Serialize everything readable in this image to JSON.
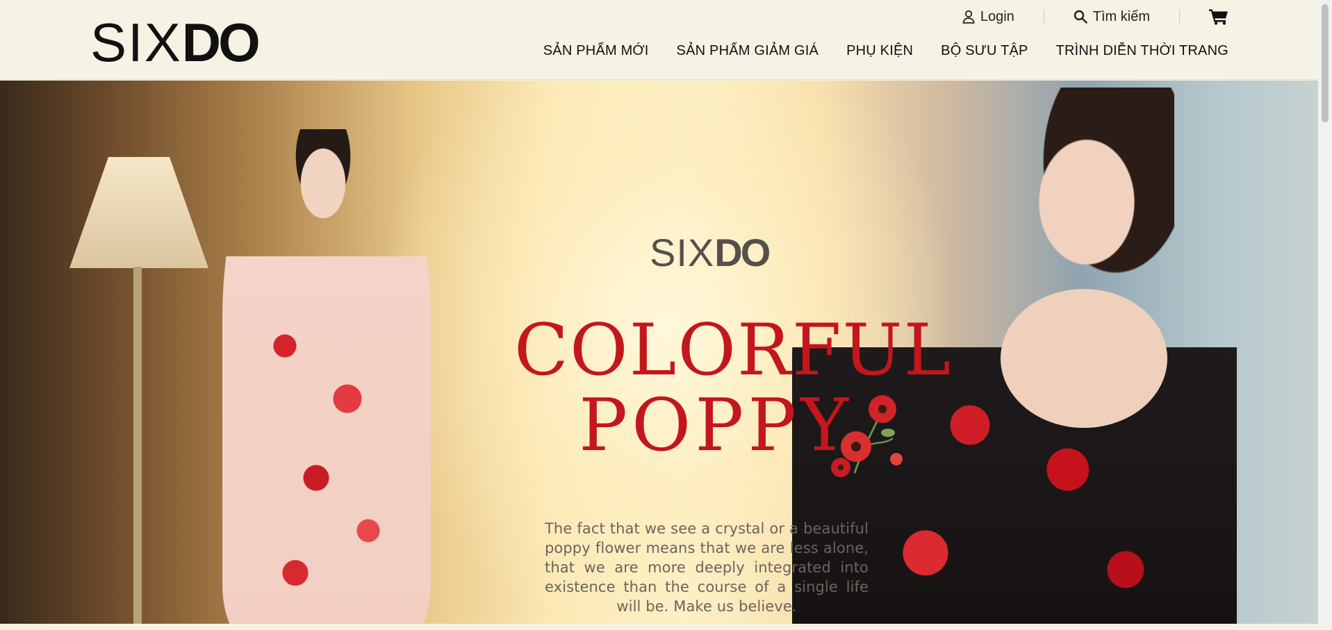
{
  "header": {
    "logo": {
      "thin": "SIX",
      "bold": "DO"
    },
    "topbar": {
      "login_label": "Login",
      "search_label": "Tìm kiếm"
    },
    "nav": [
      {
        "label": "SẢN PHẨM MỚI"
      },
      {
        "label": "SẢN PHẨM GIẢM GIÁ"
      },
      {
        "label": "PHỤ KIỆN"
      },
      {
        "label": "BỘ SƯU TẬP"
      },
      {
        "label": "TRÌNH DIỄN THỜI TRANG"
      }
    ]
  },
  "hero": {
    "brand": {
      "thin": "SIX",
      "bold": "DO"
    },
    "title_line1": "COLORFUL",
    "title_line2": "POPPY",
    "text": "The fact that we see a crystal or a beautiful poppy flower means that we are less alone, that we are more deeply integrated into existence than the course of a single life will be. Make us believe."
  },
  "icons": {
    "user": "user-icon",
    "search": "search-icon",
    "cart": "cart-icon",
    "poppy": "poppy-flower-icon"
  },
  "colors": {
    "header_bg": "#f6f2e4",
    "title_red": "#c3161d",
    "text_gray": "#6b645c"
  }
}
